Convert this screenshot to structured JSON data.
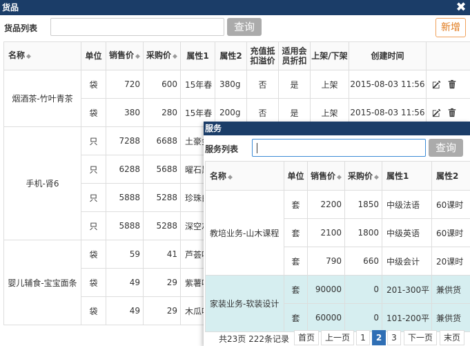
{
  "goods_window": {
    "title": "货品",
    "close_glyph": "✖",
    "search_label": "货品列表",
    "search_value": "",
    "query_label": "查询",
    "add_label": "新增",
    "columns": [
      "名称",
      "单位",
      "销售价",
      "采购价",
      "属性1",
      "属性2",
      "充值抵扣溢价",
      "适用会员折扣",
      "上架/下架",
      "创建时间",
      ""
    ],
    "sort_glyph": "◆",
    "groups": [
      {
        "name": "烟酒茶-竹叶青茶",
        "rows": [
          {
            "unit": "袋",
            "sale": "720",
            "buy": "600",
            "attr1": "15年春",
            "attr2": "380g",
            "recharge": "否",
            "member": "是",
            "status": "上架",
            "created": "2015-08-03 11:56"
          },
          {
            "unit": "袋",
            "sale": "380",
            "buy": "280",
            "attr1": "15年春",
            "attr2": "200g",
            "recharge": "否",
            "member": "是",
            "status": "上架",
            "created": "2015-08-03 11:56"
          }
        ]
      },
      {
        "name": "手机-肾6",
        "rows": [
          {
            "unit": "只",
            "sale": "7288",
            "buy": "6688",
            "attr1": "土豪金"
          },
          {
            "unit": "只",
            "sale": "6288",
            "buy": "5688",
            "attr1": "曜石黑"
          },
          {
            "unit": "只",
            "sale": "5888",
            "buy": "5288",
            "attr1": "珍珠白"
          },
          {
            "unit": "只",
            "sale": "5888",
            "buy": "5288",
            "attr1": "深空灰"
          }
        ]
      },
      {
        "name": "婴儿辅食-宝宝面条",
        "rows": [
          {
            "unit": "袋",
            "sale": "59",
            "buy": "41",
            "attr1": "芦荟味"
          },
          {
            "unit": "袋",
            "sale": "49",
            "buy": "29",
            "attr1": "紫薯味"
          },
          {
            "unit": "袋",
            "sale": "49",
            "buy": "29",
            "attr1": "木瓜味"
          }
        ]
      }
    ]
  },
  "service_window": {
    "title": "服务",
    "search_label": "服务列表",
    "search_value": "",
    "query_label": "查询",
    "columns": [
      "名称",
      "单位",
      "销售价",
      "采购价",
      "属性1",
      "属性2"
    ],
    "sort_glyph": "◆",
    "groups": [
      {
        "name": "教培业务-山木课程",
        "rows": [
          {
            "unit": "套",
            "sale": "2200",
            "buy": "1850",
            "attr1": "中级法语",
            "attr2": "60课时"
          },
          {
            "unit": "套",
            "sale": "2100",
            "buy": "1800",
            "attr1": "中级英语",
            "attr2": "60课时"
          },
          {
            "unit": "套",
            "sale": "790",
            "buy": "660",
            "attr1": "中级会计",
            "attr2": "20课时"
          }
        ]
      },
      {
        "name": "家装业务-软装设计",
        "highlight": true,
        "rows": [
          {
            "unit": "套",
            "sale": "90000",
            "buy": "0",
            "attr1": "201-300平",
            "attr2": "兼供货"
          },
          {
            "unit": "套",
            "sale": "60000",
            "buy": "0",
            "attr1": "101-200平",
            "attr2": "兼供货"
          }
        ]
      }
    ],
    "pager": {
      "info": "共23页  222条记录",
      "first": "首页",
      "prev": "上一页",
      "pages": [
        "1",
        "2",
        "3"
      ],
      "current": "2",
      "next": "下一页",
      "last": "末页"
    }
  },
  "colors": {
    "titlebar": "#1b3d68",
    "query_button": "#ababab",
    "add_button_border": "#f0a05a",
    "active_page": "#2f6fb5",
    "highlight_row": "#d6eef0"
  }
}
